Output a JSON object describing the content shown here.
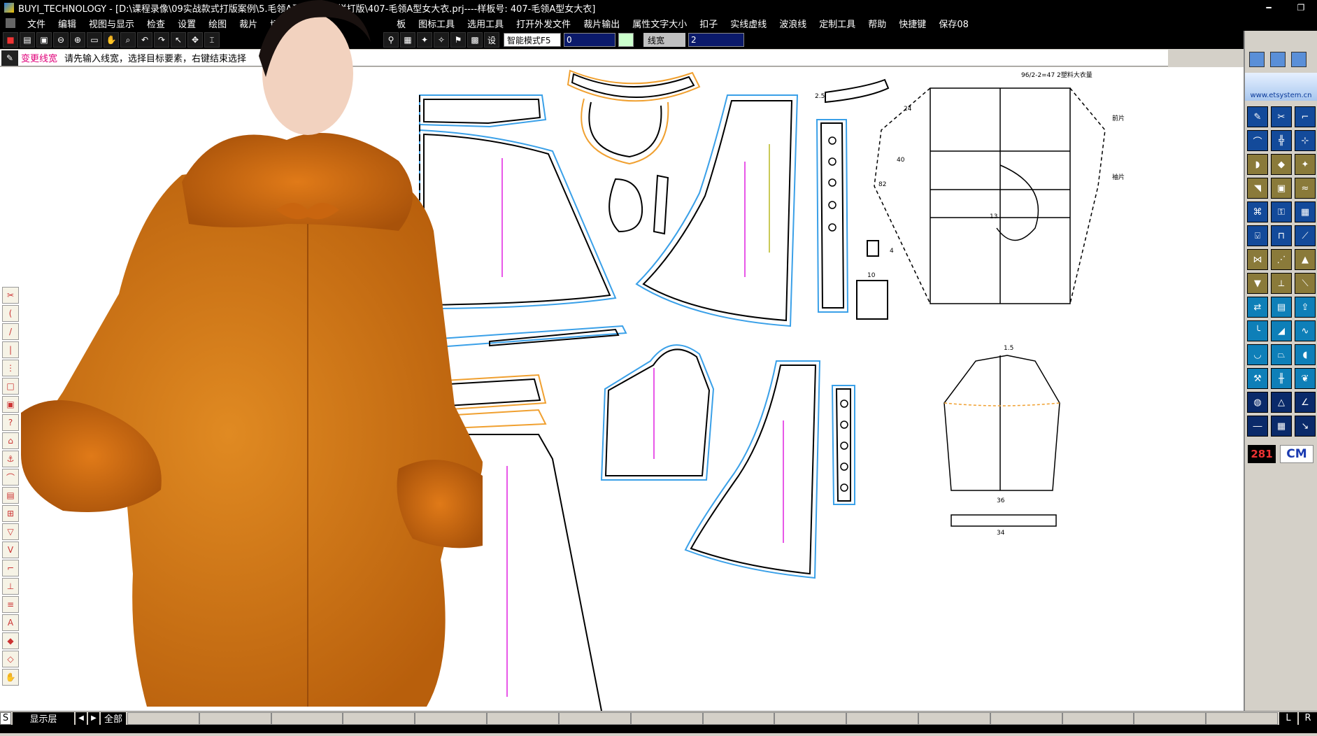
{
  "window": {
    "title": "BUYI_TECHNOLOGY - [D:\\课程录像\\09实战款式打版案例\\5.毛领A型女大衣纸样打版\\407-毛领A型女大衣.prj----样板号: 407-毛领A型女大衣]",
    "minimize": "━",
    "restore": "❐"
  },
  "menu": {
    "items": [
      "文件",
      "编辑",
      "视图与显示",
      "检查",
      "设置",
      "绘图",
      "裁片",
      "切",
      "板",
      "图标工具",
      "选用工具",
      "打开外发文件",
      "裁片输出",
      "属性文字大小",
      "扣子",
      "实线虚线",
      "波浪线",
      "定制工具",
      "帮助",
      "快捷键",
      "保存08"
    ]
  },
  "toolbar": {
    "mode_select": "智能模式F5",
    "value_field": "0",
    "linewidth_label": "线宽",
    "linewidth_value": "2"
  },
  "prompt": {
    "command": "变更线宽",
    "message": "请先输入线宽，选择目标要素，右键结束选择"
  },
  "canvas": {
    "labels": {
      "measure_note": "96/2-2=47  2塑料大衣量",
      "dim_24": "24",
      "dim_40": "40",
      "dim_82": "82",
      "dim_13": "13",
      "dim_36": "36",
      "dim_34": "34",
      "dim_10": "10",
      "dim_4": "4",
      "dim_1_5": "1.5",
      "dim_2_5": "2.5",
      "note_bodice": "前片",
      "note_sleeve": "袖片"
    }
  },
  "right_panel": {
    "logo_text": "www.etsystem.cn",
    "piece_count": "281",
    "unit": "CM"
  },
  "statusbar": {
    "s_label": "S",
    "layer_label": "显示层",
    "all_label": "全部",
    "l_label": "L",
    "r_label": "R"
  },
  "colors": {
    "seam_blue": "#3aa0e8",
    "seam_orange": "#f0a030",
    "grain_magenta": "#e020e0",
    "outline": "#000000",
    "coat_orange": "#d9821a",
    "fur_orange": "#c8670c"
  },
  "icons": {
    "left_tools": [
      "knife-icon",
      "curve-icon",
      "line-icon",
      "ruler-icon",
      "split-icon",
      "rect-icon",
      "rect2-icon",
      "help-icon",
      "fold-icon",
      "anchor-icon",
      "notch-icon",
      "save-icon",
      "grade-icon",
      "drill-icon",
      "v-icon",
      "stair-icon",
      "measure-icon",
      "align-icon",
      "text-icon",
      "droplet-icon",
      "water-icon",
      "hand-icon"
    ],
    "right_tools": [
      "pen-icon",
      "scissor-icon",
      "hook-icon",
      "curve-icon",
      "grid-icon",
      "compass-icon",
      "drape-icon",
      "diamond-icon",
      "cut-icon",
      "dart-icon",
      "tag-icon",
      "stitch-icon",
      "sew-icon",
      "key-icon",
      "grid2-icon",
      "shirt-icon",
      "pants-icon",
      "sleeve-icon",
      "fold-icon",
      "seam-icon",
      "pleat-icon",
      "needle-icon",
      "ruler-icon",
      "pin-icon",
      "mirror-icon",
      "save-icon",
      "export-icon",
      "bend-icon",
      "hip-icon",
      "wave-icon",
      "cup-icon",
      "skirt-icon",
      "toe-icon",
      "tool-icon",
      "split-icon",
      "leaf-icon",
      "globe-icon",
      "triangle-icon",
      "angle-icon",
      "line-icon",
      "grid3-icon",
      "arrow-icon"
    ]
  }
}
